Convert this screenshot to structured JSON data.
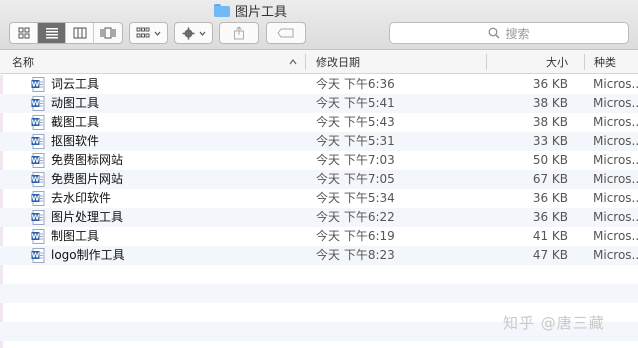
{
  "window": {
    "title": "图片工具"
  },
  "toolbar": {
    "view_buttons": [
      "icon-view",
      "list-view",
      "column-view",
      "coverflow-view"
    ],
    "search_placeholder": "搜索"
  },
  "columns": {
    "name": "名称",
    "date": "修改日期",
    "size": "大小",
    "kind": "种类"
  },
  "files": [
    {
      "name": "词云工具",
      "date": "今天 下午6:36",
      "size": "36 KB",
      "kind": "Micros..."
    },
    {
      "name": "动图工具",
      "date": "今天 下午5:41",
      "size": "38 KB",
      "kind": "Micros..."
    },
    {
      "name": "截图工具",
      "date": "今天 下午5:43",
      "size": "38 KB",
      "kind": "Micros..."
    },
    {
      "name": "抠图软件",
      "date": "今天 下午5:31",
      "size": "33 KB",
      "kind": "Micros..."
    },
    {
      "name": "免费图标网站",
      "date": "今天 下午7:03",
      "size": "50 KB",
      "kind": "Micros..."
    },
    {
      "name": "免费图片网站",
      "date": "今天 下午7:05",
      "size": "67 KB",
      "kind": "Micros..."
    },
    {
      "name": "去水印软件",
      "date": "今天 下午5:34",
      "size": "36 KB",
      "kind": "Micros..."
    },
    {
      "name": "图片处理工具",
      "date": "今天 下午6:22",
      "size": "36 KB",
      "kind": "Micros..."
    },
    {
      "name": "制图工具",
      "date": "今天 下午6:19",
      "size": "41 KB",
      "kind": "Micros..."
    },
    {
      "name": "logo制作工具",
      "date": "今天 下午8:23",
      "size": "47 KB",
      "kind": "Micros..."
    }
  ],
  "watermark": "知乎 @唐三藏"
}
